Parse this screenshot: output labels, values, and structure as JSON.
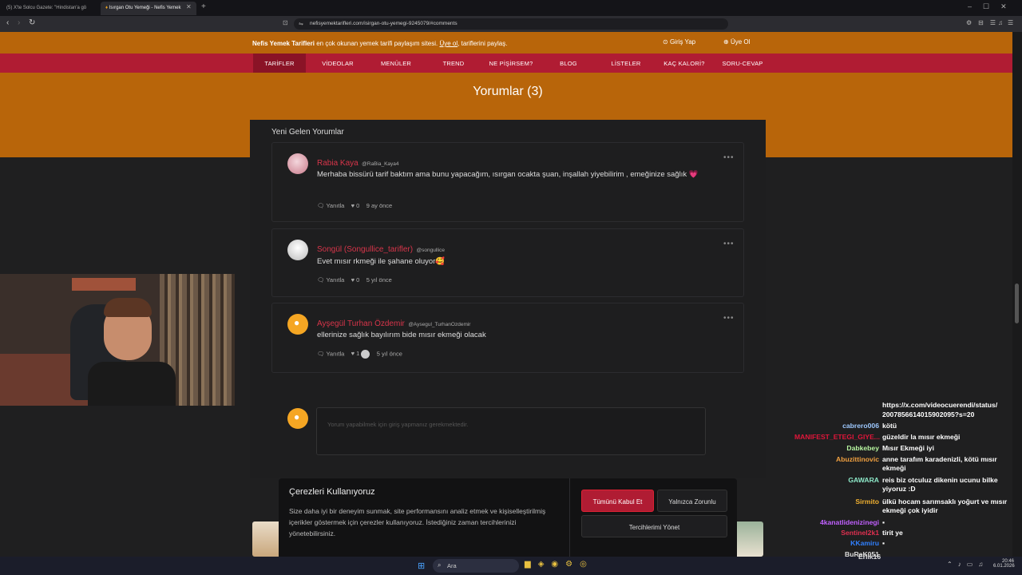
{
  "browser": {
    "tabs": [
      {
        "label": "(5) X'te Solcu Gazete: \"Hindistan'a gö"
      },
      {
        "label": "Isırgan Otu Yemeği - Nefis Yemek"
      }
    ],
    "new_tab": "+",
    "url": "nefisyemektarifleri.com/isirgan-otu-yemegi-9245079/#comments"
  },
  "site": {
    "topbar": {
      "brand": "Nefis Yemek Tarifleri",
      "text": " en çok okunan yemek tarifi paylaşım sitesi. ",
      "link": "Üye ol",
      "text2": ", tariflerini paylaş.",
      "login": "Giriş Yap",
      "signup": "Üye Ol"
    },
    "nav": [
      "TARİFLER",
      "VİDEOLAR",
      "MENÜLER",
      "TREND",
      "NE PİŞİRSEM?",
      "BLOG",
      "LİSTELER",
      "KAÇ KALORİ?",
      "SORU-CEVAP"
    ],
    "comments_title": "Yorumlar (3)",
    "section_title": "Yeni Gelen Yorumlar",
    "comments": [
      {
        "name": "Rabia Kaya",
        "handle": "@RaBia_Kaya4",
        "text": "Merhaba bissürü tarif baktım ama bunu yapacağım, ısırgan ocakta şuan, inşallah yiyebilirim , emeğinize sağlık 💗",
        "reply": "Yanıtla",
        "likes": "0",
        "time": "9 ay önce"
      },
      {
        "name": "Songül (Songullice_tarifler)",
        "handle": "@songullice",
        "text": "Evet mısır rkmeği ile şahane oluyor🥰",
        "reply": "Yanıtla",
        "likes": "0",
        "time": "5 yıl önce"
      },
      {
        "name": "Ayşegül Turhan Özdemir",
        "handle": "@Aysegul_TurhanOzdemir",
        "text": "ellerinize sağlık bayılırım bide mısır ekmeği olacak",
        "reply": "Yanıtla",
        "likes": "1",
        "time": "5 yıl önce"
      }
    ],
    "comment_placeholder": "Yorum yapabilmek için giriş yapmanız gerekmektedir.",
    "cookie": {
      "title": "Çerezleri Kullanıyoruz",
      "text": "Size daha iyi bir deneyim sunmak, site performansını analiz etmek ve kişiselleştirilmiş içerikler göstermek için çerezler kullanıyoruz. İstediğiniz zaman tercihlerinizi yönetebilirsiniz.",
      "accept": "Tümünü Kabul Et",
      "necessary": "Yalnızca Zorunlu",
      "manage": "Tercihlerimi Yönet"
    }
  },
  "chat": [
    {
      "user": "",
      "msg": "https://x.com/videocuerendi/status/",
      "color": "#ffffff"
    },
    {
      "user": "",
      "msg": "2007856614015902095?s=20",
      "color": "#ffffff"
    },
    {
      "user": "cabrero006",
      "msg": "kötü",
      "color": "#9ec9ff"
    },
    {
      "user": "MANIFEST_ETEGI_GIYE...",
      "msg": "güzeldir la mısır ekmeği",
      "color": "#e0163a"
    },
    {
      "user": "Dabkebey",
      "msg": "Mısır Ekmeği iyi",
      "color": "#b7f5a0"
    },
    {
      "user": "Abuzittinovic",
      "msg": "anne tarafım karadenizli, kötü mısır ekmeği",
      "color": "#f0a040"
    },
    {
      "user": "GAWARA",
      "msg": "reis biz otculuz dikenin ucunu bilke yiyoruz :D",
      "color": "#8de8c8"
    },
    {
      "user": "Sirmito",
      "msg": "ülkü hocam sarımsaklı yoğurt ve mısır ekmeği çok iyidir",
      "color": "#f0b030"
    },
    {
      "user": "4kanatlidenizinegi",
      "msg": "",
      "color": "#c060ff"
    },
    {
      "user": "Sentinel2k1",
      "msg": "tirit ye",
      "color": "#e03050"
    },
    {
      "user": "KKamiru",
      "msg": "",
      "color": "#3080ff"
    },
    {
      "user": "BuRaK051",
      "msg": "",
      "color": "#dddddd"
    },
    {
      "user": "Erlik16",
      "msg": "",
      "color": "#dddddd"
    }
  ],
  "taskbar": {
    "search": "Ara",
    "time": "20:46",
    "date": "6.01.2026"
  }
}
